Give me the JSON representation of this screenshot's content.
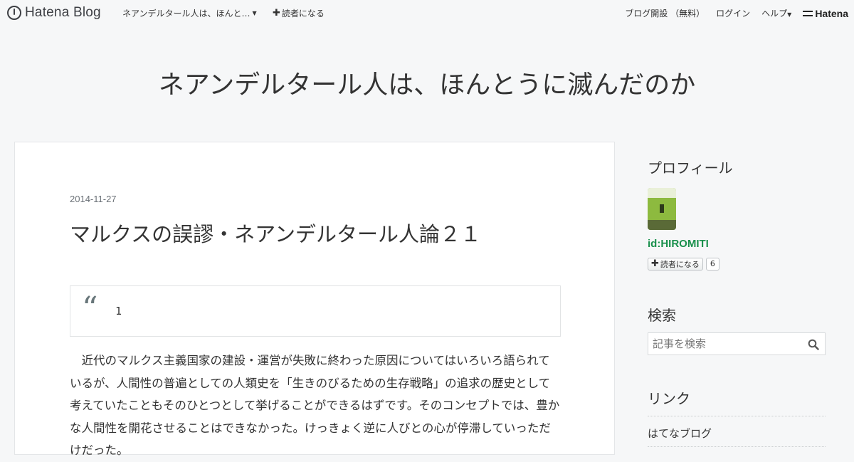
{
  "topbar": {
    "logo_text": "Hatena Blog",
    "blog_menu_label": "ネアンデルタール人は、ほんと…",
    "subscribe_label": "読者になる",
    "create_blog_label": "ブログ開設 （無料）",
    "login_label": "ログイン",
    "help_label": "ヘルプ",
    "brand_label": "Hatena"
  },
  "blog": {
    "title": "ネアンデルタール人は、ほんとうに滅んだのか"
  },
  "entry": {
    "date": "2014-11-27",
    "title": "マルクスの誤謬・ネアンデルタール人論２１",
    "quote_mark": "“",
    "quote_text": "1",
    "body_lines": [
      "近代のマルクス主義国家の建設・運営が失敗に終わった原因についてはいろいろ語られているが、人間性の普遍としての人類史を「生きのびるための生存戦略」の追求の歴史として考えていたこともそのひとつとして挙げることができるはずです。そのコンセプトでは、豊かな人間性を開花させることはできなかった。けっきょく逆に人びとの心が停滞していっただけだった。"
    ]
  },
  "sidebar": {
    "profile_heading": "プロフィール",
    "profile_id": "id:HIROMITI",
    "subscribe_label": "読者になる",
    "subscriber_count": "6",
    "search_heading": "検索",
    "search_placeholder": "記事を検索",
    "links_heading": "リンク",
    "links": [
      "はてなブログ"
    ]
  },
  "icons": {
    "logo": "hatena-blog-logo-icon",
    "search": "search-icon",
    "plus": "plus-icon",
    "caret": "caret-down-icon"
  }
}
